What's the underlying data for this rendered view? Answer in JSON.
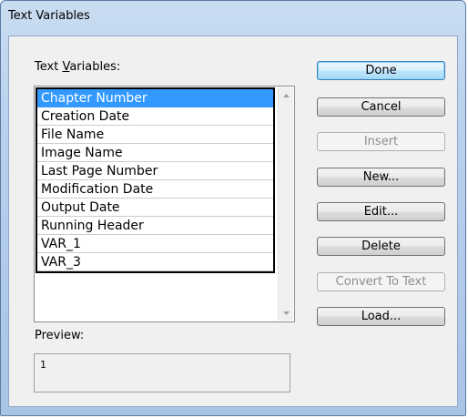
{
  "window": {
    "title": "Text Variables"
  },
  "list": {
    "label": "Text Variables:",
    "label_pre": "Text ",
    "label_accel": "V",
    "label_post": "ariables:",
    "items": [
      "Chapter Number",
      "Creation Date",
      "File Name",
      "Image Name",
      "Last Page Number",
      "Modification Date",
      "Output Date",
      "Running Header",
      "VAR_1",
      "VAR_3"
    ],
    "selected": "Chapter Number"
  },
  "preview": {
    "label": "Preview:",
    "value": "1"
  },
  "buttons": {
    "done": "Done",
    "cancel": "Cancel",
    "insert": "Insert",
    "new": "New...",
    "edit": "Edit...",
    "delete": "Delete",
    "convert": "Convert To Text",
    "load": "Load..."
  },
  "icons": {
    "scroll_up": "chevron-up-icon",
    "scroll_down": "chevron-down-icon"
  }
}
